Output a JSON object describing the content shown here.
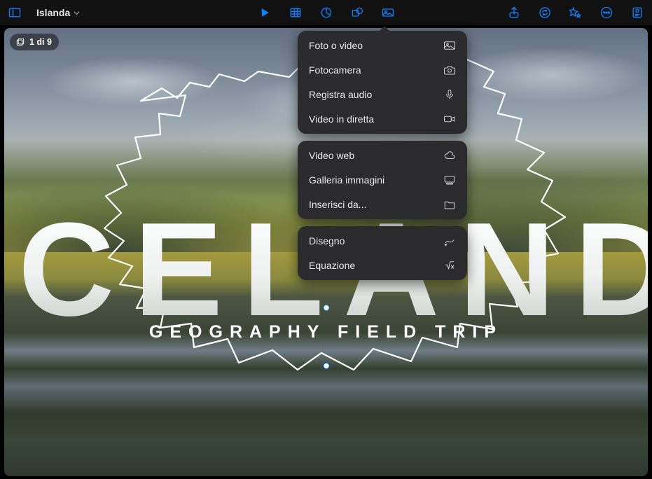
{
  "toolbar": {
    "doc_title": "Islanda"
  },
  "slide_badge": {
    "counter": "1 di 9"
  },
  "slide": {
    "title": "ICELAND",
    "subtitle": "GEOGRAPHY FIELD TRIP"
  },
  "insert_menu": {
    "groups": [
      {
        "items": [
          {
            "label": "Foto o video",
            "icon": "photo-icon"
          },
          {
            "label": "Fotocamera",
            "icon": "camera-icon"
          },
          {
            "label": "Registra audio",
            "icon": "mic-icon"
          },
          {
            "label": "Video in diretta",
            "icon": "video-icon"
          }
        ]
      },
      {
        "items": [
          {
            "label": "Video web",
            "icon": "cloud-icon"
          },
          {
            "label": "Galleria immagini",
            "icon": "gallery-icon"
          },
          {
            "label": "Inserisci da...",
            "icon": "folder-icon"
          }
        ]
      },
      {
        "items": [
          {
            "label": "Disegno",
            "icon": "draw-icon"
          },
          {
            "label": "Equazione",
            "icon": "equation-icon"
          }
        ]
      }
    ]
  }
}
